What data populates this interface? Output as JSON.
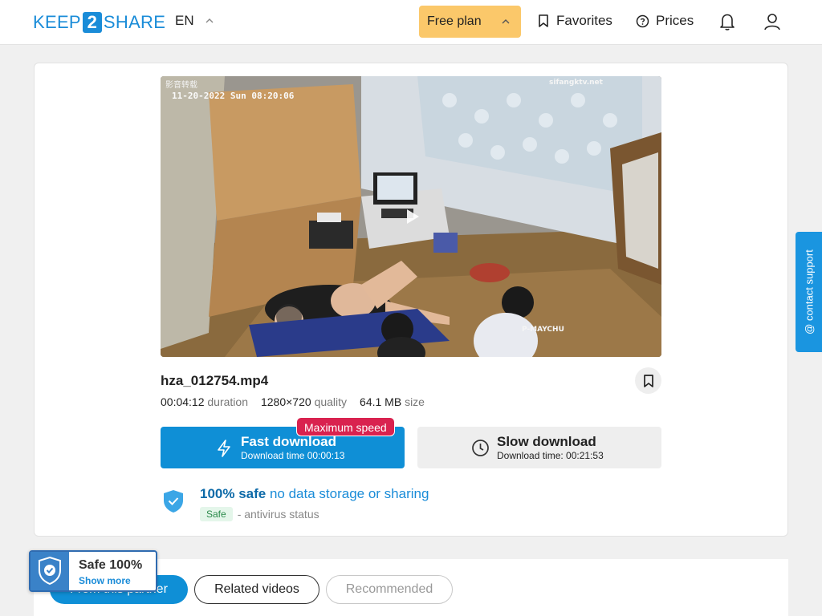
{
  "header": {
    "logo_pre": "KEEP",
    "logo_mid": "2",
    "logo_post": "SHARE",
    "language": "EN",
    "plan_label": "Free plan",
    "favorites_label": "Favorites",
    "prices_label": "Prices"
  },
  "video": {
    "overlay_channel": "影音转载",
    "overlay_timestamp": "11-20-2022 Sun 08:20:06",
    "overlay_watermark": "sifangktv.net",
    "overlay_name": "P-MAYCHU"
  },
  "file": {
    "name": "hza_012754.mp4",
    "duration_value": "00:04:12",
    "duration_label": "duration",
    "quality_value": "1280×720",
    "quality_label": "quality",
    "size_value": "64.1 MB",
    "size_label": "size"
  },
  "download": {
    "fast_title": "Fast download",
    "fast_sub": "Download time 00:00:13",
    "max_speed_badge": "Maximum speed",
    "slow_title": "Slow download",
    "slow_sub": "Download time: 00:21:53"
  },
  "safety": {
    "headline_bold": "100% safe",
    "headline_rest": "no data storage or sharing",
    "badge": "Safe",
    "status_text": "- antivirus status"
  },
  "support": {
    "label": "@ contact support"
  },
  "tabs": [
    {
      "label": "From this partner"
    },
    {
      "label": "Related videos"
    },
    {
      "label": "Recommended"
    }
  ],
  "safe_widget": {
    "title": "Safe 100%",
    "link": "Show more"
  },
  "colors": {
    "accent": "#0f8fd6",
    "plan": "#fbc86a",
    "badge_red": "#d9224f"
  }
}
